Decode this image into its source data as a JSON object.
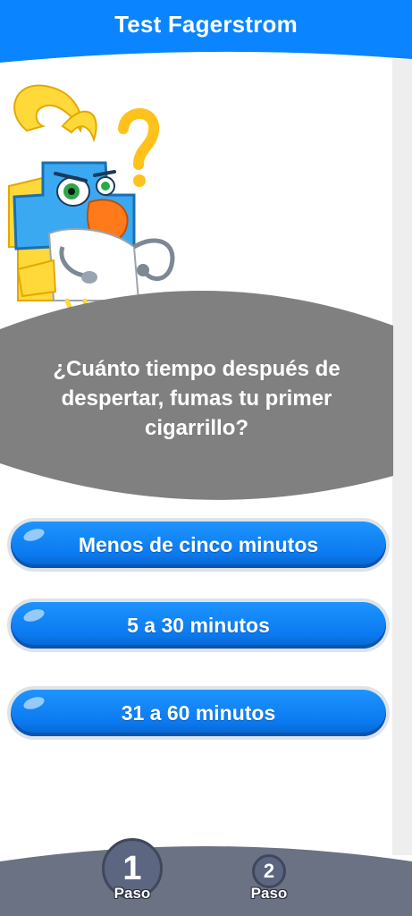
{
  "header": {
    "title": "Test Fagerstrom"
  },
  "mascot": {
    "icon": "doctor-bird-mascot-icon"
  },
  "question": {
    "text": "¿Cuánto tiempo después de despertar, fumas tu primer cigarrillo?"
  },
  "answers": [
    {
      "label": "Menos de cinco minutos"
    },
    {
      "label": "5 a 30 minutos"
    },
    {
      "label": "31 a 60 minutos"
    }
  ],
  "steps": [
    {
      "number": "1",
      "label": "Paso",
      "active": true
    },
    {
      "number": "2",
      "label": "Paso",
      "active": false
    }
  ],
  "colors": {
    "header": "#0a84ff",
    "question_panel": "#808080",
    "answer_button": "#0b7af0",
    "footer": "#6b7283"
  }
}
